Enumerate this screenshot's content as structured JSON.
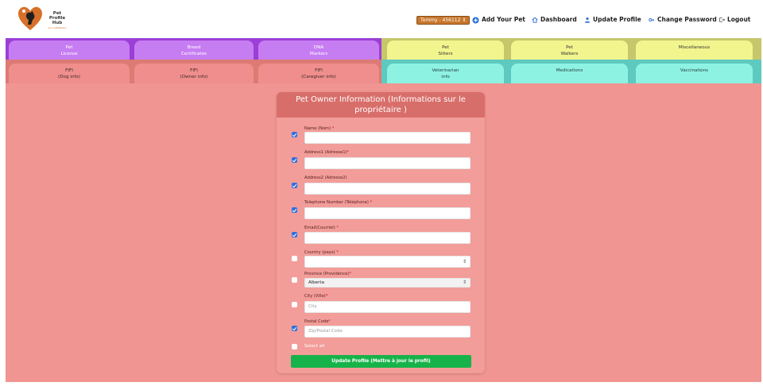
{
  "header": {
    "logo_title": "Pet Profile Hub",
    "logo_subtitle": "by LinkPetCare",
    "user_select": "Tommy - 456112",
    "nav": [
      {
        "label": "Add Your Pet",
        "icon": "plus-circle-icon"
      },
      {
        "label": "Dashboard",
        "icon": "home-icon"
      },
      {
        "label": "Update Profile",
        "icon": "user-icon"
      },
      {
        "label": "Change Password",
        "icon": "key-icon"
      },
      {
        "label": "Logout",
        "icon": "logout-icon"
      }
    ]
  },
  "tabs": {
    "row1": [
      {
        "line1": "Pet",
        "line2": "License"
      },
      {
        "line1": "Breed",
        "line2": "Certificates"
      },
      {
        "line1": "DNA",
        "line2": "Markers"
      },
      {
        "line1": "Pet",
        "line2": "Sitters"
      },
      {
        "line1": "Pet",
        "line2": "Walkers"
      },
      {
        "line1": "Miscellaneous",
        "line2": ""
      }
    ],
    "row2": [
      {
        "line1": "FIFI",
        "line2": "(Dog info)"
      },
      {
        "line1": "FIFI",
        "line2": "(Owner info)"
      },
      {
        "line1": "FIFI",
        "line2": "(Caregiver info)"
      },
      {
        "line1": "Veterinarian",
        "line2": "info"
      },
      {
        "line1": "Medications",
        "line2": ""
      },
      {
        "line1": "Vaccinations",
        "line2": ""
      }
    ]
  },
  "form": {
    "title": "Pet Owner Information (Informations sur le propriétaire )",
    "fields": [
      {
        "label": "Name (Nom)",
        "required": "*",
        "value": "",
        "placeholder": "",
        "checked": true
      },
      {
        "label": "Address1 (Adresse1)",
        "required": "*",
        "value": "",
        "placeholder": "",
        "checked": true
      },
      {
        "label": "Address2 (Adresse2)",
        "required": "",
        "value": "",
        "placeholder": "",
        "checked": true
      },
      {
        "label": "Telephone Number (Téléphone)",
        "required": "*",
        "value": "",
        "placeholder": "",
        "checked": true
      },
      {
        "label": "Email(Courriel)",
        "required": "*",
        "value": "",
        "placeholder": "",
        "checked": true
      },
      {
        "label": "Country (pays)",
        "required": "*",
        "value": "",
        "placeholder": "",
        "checked": false
      },
      {
        "label": "Province (Providence)",
        "required": "*",
        "value": "Alberta",
        "placeholder": "",
        "checked": false
      },
      {
        "label": "City (Ville)",
        "required": "*",
        "value": "",
        "placeholder": "City",
        "checked": false
      },
      {
        "label": "Postal Code",
        "required": "*",
        "value": "",
        "placeholder": "Zip/Postal Code",
        "checked": true
      }
    ],
    "select_all_label": "Select all",
    "submit_label": "Update Profile (Mettre à jour le profil)"
  },
  "colors": {
    "accent_green": "#17b34a",
    "checkbox_blue": "#2f6fe0",
    "background_salmon": "#f09591"
  }
}
